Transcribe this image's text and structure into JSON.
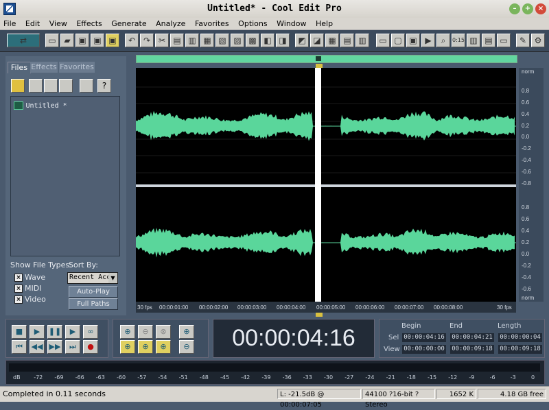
{
  "window": {
    "title": "Untitled* - Cool Edit Pro"
  },
  "menu": [
    "File",
    "Edit",
    "View",
    "Effects",
    "Generate",
    "Analyze",
    "Favorites",
    "Options",
    "Window",
    "Help"
  ],
  "panel": {
    "tabs": [
      "Files",
      "Effects",
      "Favorites"
    ],
    "files": [
      {
        "name": "Untitled *"
      }
    ],
    "show_file_types_label": "Show File Types:",
    "sort_by_label": "Sort By:",
    "file_types": [
      {
        "label": "Wave",
        "checked": true
      },
      {
        "label": "MIDI",
        "checked": true
      },
      {
        "label": "Video",
        "checked": true
      }
    ],
    "sort_value": "Recent Acc",
    "auto_play": "Auto-Play",
    "full_paths": "Full Paths"
  },
  "ruler": {
    "top": [
      "norm",
      "0.8",
      "0.6",
      "0.4",
      "0.2",
      "0.0",
      "-0.2",
      "-0.4",
      "-0.6",
      "-0.8"
    ],
    "bottom": [
      "0.8",
      "0.6",
      "0.4",
      "0.2",
      "0.0",
      "-0.2",
      "-0.4",
      "-0.6",
      "norm"
    ]
  },
  "timeline": {
    "labels": [
      "30 fps",
      "00:00:01:00",
      "00:00:02:00",
      "00:00:03:00",
      "00:00:04:00",
      "00:00:05:00",
      "00:00:06:00",
      "00:00:07:00",
      "00:00:08:00",
      "30 fps"
    ]
  },
  "time_display": "00:00:04:16",
  "selection": {
    "headers": [
      "Begin",
      "End",
      "Length"
    ],
    "sel_label": "Sel",
    "view_label": "View",
    "sel": [
      "00:00:04:16",
      "00:00:04:21",
      "00:00:00:04"
    ],
    "view": [
      "00:00:00:00",
      "00:00:09:18",
      "00:00:09:18"
    ]
  },
  "levels": {
    "labels": [
      "dB",
      "-72",
      "-69",
      "-66",
      "-63",
      "-60",
      "-57",
      "-54",
      "-51",
      "-48",
      "-45",
      "-42",
      "-39",
      "-36",
      "-33",
      "-30",
      "-27",
      "-24",
      "-21",
      "-18",
      "-15",
      "-12",
      "-9",
      "-6",
      "-3",
      "0"
    ]
  },
  "status": {
    "message": "Completed in 0.11 seconds",
    "level": "L: -21.5dB @ 00:00:07:05",
    "format": "44100 ?16-bit ?Stereo",
    "size": "1652 K",
    "free": "4.18 GB free"
  },
  "colors": {
    "waveform": "#5ad69b",
    "accent": "#62d6a0"
  }
}
